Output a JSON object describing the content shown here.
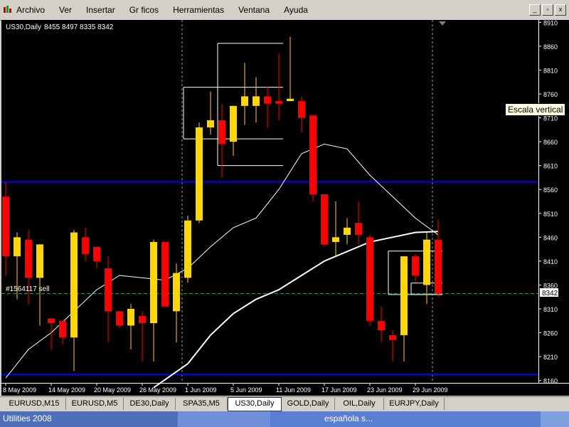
{
  "menu": {
    "items": [
      "Archivo",
      "Ver",
      "Insertar",
      "Gr ficos",
      "Herramientas",
      "Ventana",
      "Ayuda"
    ]
  },
  "window": {
    "minimize_label": "_",
    "restore_label": "▫",
    "close_label": "x"
  },
  "colors": {
    "bull_candle": "#ffd700",
    "bear_candle": "#ff0000",
    "horizontal_lines": "#0000ff",
    "moving_averages": "#ffffff",
    "price_line": "#2e8b57"
  },
  "chart_data": {
    "type": "candlestick",
    "title": "US30,Daily",
    "ohlc_header": "8455 8497 8335 8342",
    "x_tick_labels": [
      "8 May 2009",
      "14 May 2009",
      "20 May 2009",
      "26 May 2009",
      "1 Jun 2009",
      "5 Jun 2009",
      "11 Jun 2009",
      "17 Jun 2009",
      "23 Jun 2009",
      "29 Jun 2009"
    ],
    "y_tick_labels": [
      "8910",
      "8860",
      "8810",
      "8760",
      "8710",
      "8660",
      "8610",
      "8560",
      "8510",
      "8460",
      "8410",
      "8360",
      "8310",
      "8260",
      "8210",
      "8160"
    ],
    "ylim": [
      8155,
      8915
    ],
    "current_price": "8342",
    "order_label": "#1564117 sell",
    "horizontal_levels": [
      8576,
      8173
    ],
    "candles": [
      {
        "o": 8545,
        "h": 8575,
        "l": 8380,
        "c": 8420
      },
      {
        "o": 8420,
        "h": 8470,
        "l": 8330,
        "c": 8460
      },
      {
        "o": 8455,
        "h": 8475,
        "l": 8320,
        "c": 8375
      },
      {
        "o": 8375,
        "h": 8445,
        "l": 8275,
        "c": 8445
      },
      {
        "o": 8290,
        "h": 8290,
        "l": 8225,
        "c": 8280
      },
      {
        "o": 8285,
        "h": 8285,
        "l": 8235,
        "c": 8250
      },
      {
        "o": 8250,
        "h": 8475,
        "l": 8180,
        "c": 8470
      },
      {
        "o": 8460,
        "h": 8480,
        "l": 8410,
        "c": 8425
      },
      {
        "o": 8440,
        "h": 8440,
        "l": 8395,
        "c": 8410
      },
      {
        "o": 8395,
        "h": 8420,
        "l": 8240,
        "c": 8305
      },
      {
        "o": 8305,
        "h": 8305,
        "l": 8270,
        "c": 8275
      },
      {
        "o": 8275,
        "h": 8320,
        "l": 8225,
        "c": 8310
      },
      {
        "o": 8295,
        "h": 8305,
        "l": 8200,
        "c": 8280
      },
      {
        "o": 8280,
        "h": 8455,
        "l": 8200,
        "c": 8450
      },
      {
        "o": 8450,
        "h": 8450,
        "l": 8320,
        "c": 8315
      },
      {
        "o": 8305,
        "h": 8405,
        "l": 8240,
        "c": 8385
      },
      {
        "o": 8375,
        "h": 8505,
        "l": 8365,
        "c": 8495
      },
      {
        "o": 8495,
        "h": 8700,
        "l": 8490,
        "c": 8690
      },
      {
        "o": 8690,
        "h": 8765,
        "l": 8675,
        "c": 8705
      },
      {
        "o": 8705,
        "h": 8740,
        "l": 8585,
        "c": 8655
      },
      {
        "o": 8660,
        "h": 8735,
        "l": 8630,
        "c": 8735
      },
      {
        "o": 8735,
        "h": 8825,
        "l": 8695,
        "c": 8755
      },
      {
        "o": 8735,
        "h": 8795,
        "l": 8700,
        "c": 8755
      },
      {
        "o": 8755,
        "h": 8775,
        "l": 8690,
        "c": 8740
      },
      {
        "o": 8745,
        "h": 8845,
        "l": 8705,
        "c": 8740
      },
      {
        "o": 8745,
        "h": 8880,
        "l": 8745,
        "c": 8750
      },
      {
        "o": 8745,
        "h": 8755,
        "l": 8680,
        "c": 8710
      },
      {
        "o": 8715,
        "h": 8715,
        "l": 8535,
        "c": 8550
      },
      {
        "o": 8550,
        "h": 8550,
        "l": 8440,
        "c": 8445
      },
      {
        "o": 8450,
        "h": 8535,
        "l": 8420,
        "c": 8460
      },
      {
        "o": 8465,
        "h": 8500,
        "l": 8445,
        "c": 8480
      },
      {
        "o": 8490,
        "h": 8535,
        "l": 8445,
        "c": 8465
      },
      {
        "o": 8460,
        "h": 8465,
        "l": 8275,
        "c": 8285
      },
      {
        "o": 8285,
        "h": 8315,
        "l": 8240,
        "c": 8265
      },
      {
        "o": 8255,
        "h": 8265,
        "l": 8200,
        "c": 8245
      },
      {
        "o": 8255,
        "h": 8420,
        "l": 8200,
        "c": 8420
      },
      {
        "o": 8420,
        "h": 8425,
        "l": 8365,
        "c": 8380
      },
      {
        "o": 8360,
        "h": 8470,
        "l": 8320,
        "c": 8455
      },
      {
        "o": 8455,
        "h": 8497,
        "l": 8335,
        "c": 8342
      }
    ],
    "ma_fast": [
      {
        "i": 0,
        "v": 8165
      },
      {
        "i": 2,
        "v": 8225
      },
      {
        "i": 4,
        "v": 8260
      },
      {
        "i": 6,
        "v": 8305
      },
      {
        "i": 8,
        "v": 8350
      },
      {
        "i": 10,
        "v": 8380
      },
      {
        "i": 12,
        "v": 8375
      },
      {
        "i": 14,
        "v": 8370
      },
      {
        "i": 16,
        "v": 8395
      },
      {
        "i": 18,
        "v": 8440
      },
      {
        "i": 20,
        "v": 8480
      },
      {
        "i": 22,
        "v": 8500
      },
      {
        "i": 24,
        "v": 8560
      },
      {
        "i": 26,
        "v": 8635
      },
      {
        "i": 28,
        "v": 8655
      },
      {
        "i": 30,
        "v": 8645
      },
      {
        "i": 32,
        "v": 8590
      },
      {
        "i": 34,
        "v": 8545
      },
      {
        "i": 36,
        "v": 8500
      },
      {
        "i": 38,
        "v": 8465
      }
    ],
    "ma_slow": [
      {
        "i": 13,
        "v": 8145
      },
      {
        "i": 16,
        "v": 8195
      },
      {
        "i": 18,
        "v": 8255
      },
      {
        "i": 20,
        "v": 8300
      },
      {
        "i": 22,
        "v": 8330
      },
      {
        "i": 24,
        "v": 8350
      },
      {
        "i": 26,
        "v": 8380
      },
      {
        "i": 28,
        "v": 8410
      },
      {
        "i": 30,
        "v": 8430
      },
      {
        "i": 32,
        "v": 8450
      },
      {
        "i": 34,
        "v": 8460
      },
      {
        "i": 36,
        "v": 8470
      },
      {
        "i": 38,
        "v": 8472
      }
    ],
    "range_boxes": [
      {
        "i1": 19,
        "i2": 24,
        "top": 8866,
        "bottom": 8610
      },
      {
        "i1": 16,
        "i2": 24,
        "top": 8774,
        "bottom": 8666
      },
      {
        "i1": 34,
        "i2": 38,
        "top": 8431,
        "bottom": 8340
      },
      {
        "i1": 36,
        "i2": 38,
        "top": 8364,
        "bottom": 8340
      }
    ]
  },
  "tooltip": "Escala vertical",
  "symbol_tabs": [
    {
      "label": "EURUSD,M15",
      "active": false
    },
    {
      "label": "EURUSD,M5",
      "active": false
    },
    {
      "label": "DE30,Daily",
      "active": false
    },
    {
      "label": "SPA35,M5",
      "active": false
    },
    {
      "label": "US30,Daily",
      "active": true
    },
    {
      "label": "GOLD,Daily",
      "active": false
    },
    {
      "label": "OIL,Daily",
      "active": false
    },
    {
      "label": "EURJPY,Daily",
      "active": false
    }
  ],
  "taskbar": {
    "left_label": "Utilities 2008",
    "middle_label": "española s..."
  }
}
